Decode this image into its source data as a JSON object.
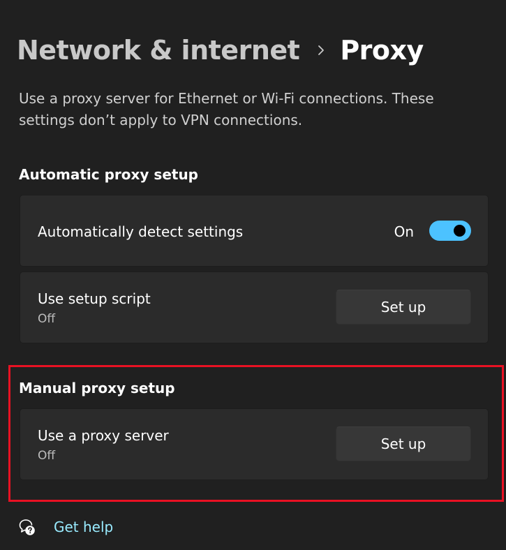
{
  "breadcrumb": {
    "parent": "Network & internet",
    "current": "Proxy"
  },
  "description": "Use a proxy server for Ethernet or Wi-Fi connections. These settings don’t apply to VPN connections.",
  "automatic": {
    "heading": "Automatic proxy setup",
    "detect": {
      "label": "Automatically detect settings",
      "state": "On",
      "enabled": true
    },
    "script": {
      "label": "Use setup script",
      "status": "Off",
      "button": "Set up"
    }
  },
  "manual": {
    "heading": "Manual proxy setup",
    "proxy": {
      "label": "Use a proxy server",
      "status": "Off",
      "button": "Set up"
    }
  },
  "help": {
    "label": "Get help",
    "icon": "help-chat-icon"
  },
  "colors": {
    "background": "#202020",
    "card": "#2b2b2b",
    "accent": "#4cc2ff",
    "link": "#99ebff",
    "highlight": "#e81123"
  }
}
